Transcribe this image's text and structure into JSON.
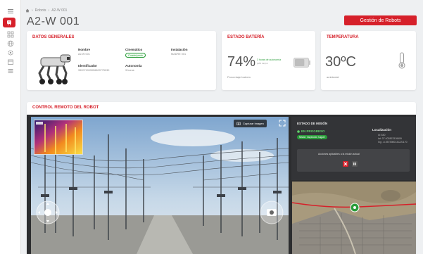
{
  "breadcrumb": {
    "home_label": "Robots",
    "current": "A2-W 001"
  },
  "page_title": "A2-W 001",
  "header_button": "Gestión de Robots",
  "general": {
    "title": "DATOS GENERALES",
    "name_label": "Nombre",
    "name_value": "A2-W 001",
    "kinematics_label": "Cinemático",
    "kinematics_value": "Cuadrúpedo",
    "install_label": "Instalación",
    "install_value": "MADRE 001",
    "id_label": "Identificador",
    "id_value": "392071909056829775030",
    "autonomy_label": "Autonomía",
    "autonomy_value": "3 horas"
  },
  "battery": {
    "title": "ESTADO BATERÍA",
    "percent": "74%",
    "note": "3 horas de autonomía",
    "note_sub": "(a70 min) m",
    "level": 0.74,
    "label": "Porcentaje batería"
  },
  "temperature": {
    "title": "TEMPERATURA",
    "value": "30ºC",
    "label": "ambiental"
  },
  "control": {
    "title": "CONTROL REMOTO DEL ROBOT",
    "capture_button": "Capturar imagen",
    "mission_title": "ESTADO DE MISIÓN",
    "mission_status": "EN PROGRESO",
    "mission_badge": "Misión: inspección huguer",
    "location_title": "Localización",
    "loc_line1": "id: 640",
    "loc_line2": "lat: 37.402803316609",
    "loc_line3": "lng: -6.0573980131221170",
    "actions_text": "Acciones aplicables a la misión actual"
  },
  "colors": {
    "accent": "#d6202a",
    "success": "#2a9d3a",
    "dark_panel": "#2c2d2f"
  },
  "icons": [
    "menu-icon",
    "robot-icon",
    "grid-icon",
    "globe-icon",
    "settings-icon",
    "calendar-icon",
    "list-icon",
    "home-icon",
    "thermometer-icon",
    "battery-icon",
    "camera-icon",
    "fullscreen-icon",
    "close-icon",
    "pause-icon",
    "joystick-icon",
    "location-marker-icon"
  ]
}
